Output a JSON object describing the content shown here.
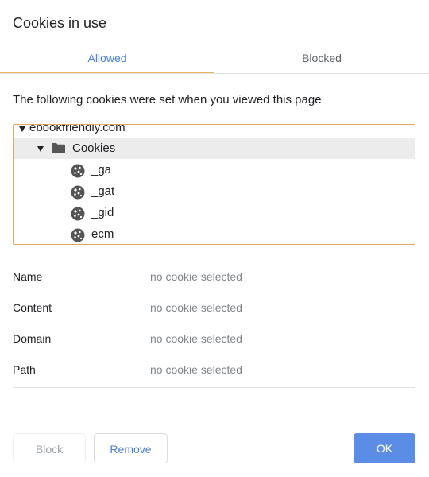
{
  "dialog": {
    "title": "Cookies in use"
  },
  "tabs": [
    {
      "label": "Allowed",
      "active": true
    },
    {
      "label": "Blocked",
      "active": false
    }
  ],
  "description": "The following cookies were set when you viewed this page",
  "tree": {
    "site": "ebookfriendly.com",
    "folder": "Cookies",
    "cookies": [
      "_ga",
      "_gat",
      "_gid",
      "ecm"
    ]
  },
  "details": [
    {
      "label": "Name",
      "value": "no cookie selected"
    },
    {
      "label": "Content",
      "value": "no cookie selected"
    },
    {
      "label": "Domain",
      "value": "no cookie selected"
    },
    {
      "label": "Path",
      "value": "no cookie selected"
    }
  ],
  "buttons": {
    "block": "Block",
    "remove": "Remove",
    "ok": "OK"
  },
  "colors": {
    "accent": "#4a7fd3",
    "tab_underline": "#e8b35a",
    "tree_border": "#d8ad5a",
    "ok_bg": "#5b8de6"
  },
  "icons": {
    "folder": "folder-icon",
    "cookie": "cookie-icon",
    "expand": "triangle-down-icon"
  }
}
